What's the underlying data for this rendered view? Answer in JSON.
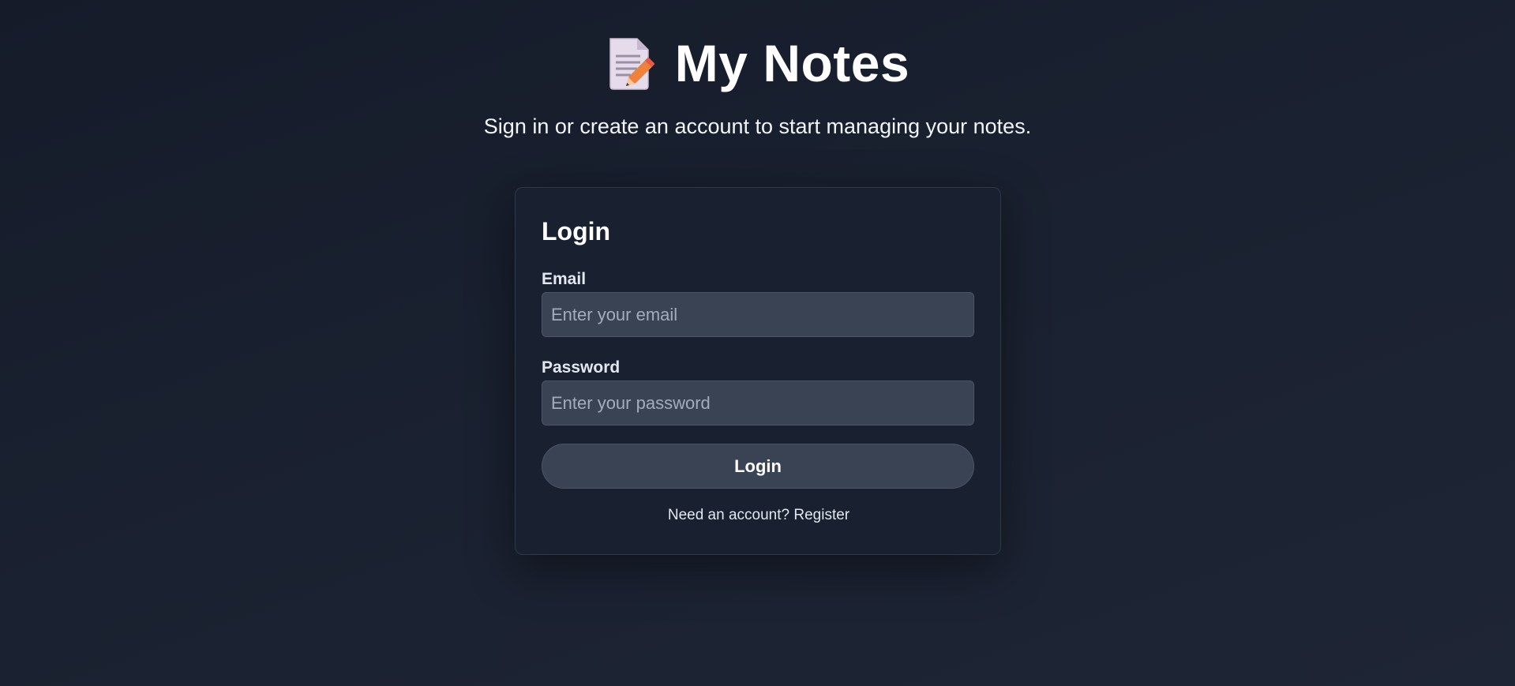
{
  "header": {
    "icon": "memo-icon",
    "title": "My Notes",
    "subtitle": "Sign in or create an account to start managing your notes."
  },
  "login_card": {
    "title": "Login",
    "email": {
      "label": "Email",
      "value": "",
      "placeholder": "Enter your email"
    },
    "password": {
      "label": "Password",
      "value": "",
      "placeholder": "Enter your password"
    },
    "submit_label": "Login",
    "register_prompt": "Need an account?",
    "register_link": "Register"
  },
  "colors": {
    "background": "#1a2130",
    "card": "#192030",
    "input": "#3a4354",
    "text": "#ffffff"
  }
}
